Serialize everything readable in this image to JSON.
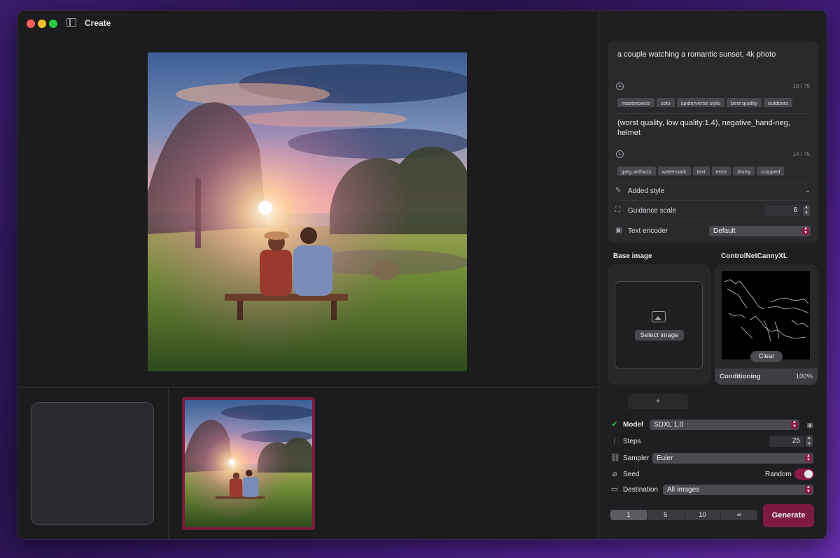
{
  "window": {
    "title": "Create"
  },
  "prompt": {
    "positive_text": "a couple watching a romantic sunset, 4k photo",
    "positive_counter": "10 / 75",
    "positive_tags": [
      "masterpiece",
      "solo",
      "spiderverse style",
      "best quality",
      "outdoors"
    ],
    "negative_text": "(worst quality, low quality:1.4), negative_hand-neg, helmet",
    "negative_counter": "14 / 75",
    "negative_tags": [
      "jpeg artifacts",
      "watermark",
      "text",
      "error",
      "blurry",
      "cropped"
    ]
  },
  "options": {
    "added_style_label": "Added style",
    "guidance_label": "Guidance scale",
    "guidance_value": "6",
    "text_encoder_label": "Text encoder",
    "text_encoder_value": "Default"
  },
  "images": {
    "base_label": "Base image",
    "select_label": "Select image",
    "controlnet_label": "ControlNetCannyXL",
    "clear_label": "Clear",
    "conditioning_label": "Conditioning",
    "conditioning_value": "100%",
    "add_label": "+"
  },
  "settings": {
    "model_label": "Model",
    "model_value": "SDXL 1.0",
    "steps_label": "Steps",
    "steps_value": "25",
    "sampler_label": "Sampler",
    "sampler_value": "Euler",
    "seed_label": "Seed",
    "random_label": "Random",
    "destination_label": "Destination",
    "destination_value": "All images"
  },
  "batch": {
    "options": [
      "1",
      "5",
      "10",
      "∞"
    ],
    "selected": "1"
  },
  "generate_label": "Generate",
  "colors": {
    "accent": "#7d1a42",
    "window_bg": "#1c1c1e",
    "panel_bg": "#1f1f22"
  }
}
